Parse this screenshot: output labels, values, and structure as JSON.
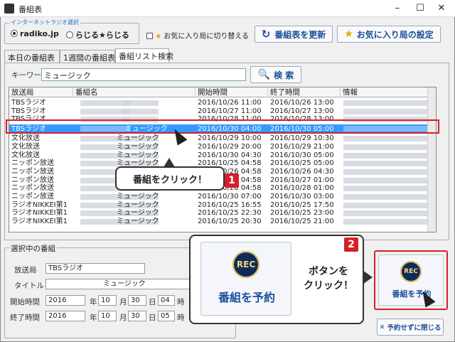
{
  "window": {
    "title": "番組表"
  },
  "radio": {
    "legend": "インターネットラジオ選択",
    "opt1": "radiko.jp",
    "opt2": "らじる★らじる"
  },
  "toolbar": {
    "fav_toggle": "お気に入り局に切り替える",
    "refresh": "番組表を更新",
    "fav_settings": "お気に入り局の設定"
  },
  "tabs": [
    {
      "label": "本日の番組表"
    },
    {
      "label": "1週間の番組表"
    },
    {
      "label": "番組リスト検索"
    }
  ],
  "search": {
    "label": "キーワード",
    "value": "ミュージック",
    "button": "検 索"
  },
  "grid": {
    "headers": [
      "放送局",
      "番組名",
      "開始時間",
      "終了時間",
      "情報"
    ],
    "rows": [
      {
        "station": "TBSラジオ",
        "program": "",
        "start": "2016/10/26 11:00",
        "end": "2016/10/26 13:00"
      },
      {
        "station": "TBSラジオ",
        "program": "",
        "start": "2016/10/27 11:00",
        "end": "2016/10/27 13:00"
      },
      {
        "station": "TBSラジオ",
        "program": "",
        "start": "2016/10/28 11:00",
        "end": "2016/10/28 13:00"
      },
      {
        "station": "TBSラジオ",
        "program": "ミュージック",
        "start": "2016/10/30 04:00",
        "end": "2016/10/30 05:00"
      },
      {
        "station": "文化放送",
        "program": "ミュージック",
        "start": "2016/10/29 10:00",
        "end": "2016/10/29 10:30"
      },
      {
        "station": "文化放送",
        "program": "ミュージック",
        "start": "2016/10/29 20:00",
        "end": "2016/10/29 21:00"
      },
      {
        "station": "文化放送",
        "program": "ミュージック",
        "start": "2016/10/30 04:30",
        "end": "2016/10/30 05:00"
      },
      {
        "station": "ニッポン放送",
        "program": "ミュージック",
        "start": "2016/10/25 04:58",
        "end": "2016/10/25 05:00"
      },
      {
        "station": "ニッポン放送",
        "program": "ミュージック",
        "start": "2016/10/26 04:58",
        "end": "2016/10/26 04:30"
      },
      {
        "station": "ニッポン放送",
        "program": "ミュージック",
        "start": "2016/10/27 04:58",
        "end": "2016/10/27 01:00"
      },
      {
        "station": "ニッポン放送",
        "program": "ミュージック",
        "start": "2016/10/28 04:58",
        "end": "2016/10/28 01:00"
      },
      {
        "station": "ニッポン放送",
        "program": "ミュージック",
        "start": "2016/10/30 07:00",
        "end": "2016/10/30 03:00"
      },
      {
        "station": "ラジオNIKKEI第1",
        "program": "ミュージック",
        "start": "2016/10/25 16:55",
        "end": "2016/10/25 17:50"
      },
      {
        "station": "ラジオNIKKEI第1",
        "program": "ミュージック",
        "start": "2016/10/25 22:30",
        "end": "2016/10/25 23:00"
      },
      {
        "station": "ラジオNIKKEI第1",
        "program": "ミュージック",
        "start": "2016/10/25 20:30",
        "end": "2016/10/25 21:00"
      }
    ]
  },
  "callout1": {
    "text": "番組をクリック！",
    "num": "1"
  },
  "callout2": {
    "text_line1": "ボタンを",
    "text_line2": "クリック！",
    "num": "2"
  },
  "selected": {
    "legend": "選択中の番組",
    "station_label": "放送局",
    "station": "TBSラジオ",
    "title_label": "タイトル",
    "title": "ミュージック",
    "start_label": "開始時間",
    "end_label": "終了時間",
    "start": {
      "year": "2016",
      "month": "10",
      "day": "30",
      "hour": "04"
    },
    "end": {
      "year": "2016",
      "month": "10",
      "day": "30",
      "hour": "05"
    },
    "u_year": "年",
    "u_month": "月",
    "u_day": "日",
    "u_hour": "時"
  },
  "reserve": {
    "rec": "REC",
    "label": "番組を予約",
    "close": "予約せずに閉じる"
  },
  "colors": {
    "accent": "#1b4f9c",
    "select": "#3399ff",
    "red": "#d4202a"
  }
}
